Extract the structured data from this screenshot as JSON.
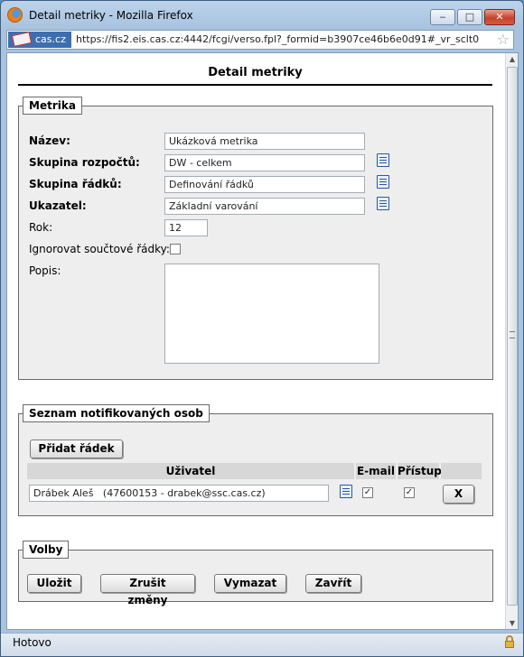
{
  "window": {
    "title": "Detail metriky - Mozilla Firefox",
    "controls": {
      "minimize": "‒",
      "maximize": "□",
      "close": "✕"
    }
  },
  "urlbar": {
    "site": "cas.cz",
    "url": "https://fis2.eis.cas.cz:4442/fcgi/verso.fpl?_formid=b3907ce46b6e0d91#_vr_sclt0",
    "bookmark_star": "☆"
  },
  "page": {
    "title": "Detail metriky"
  },
  "metrika": {
    "legend": "Metrika",
    "fields": {
      "nazev": {
        "label": "Název:",
        "value": "Ukázková metrika"
      },
      "skupina_rozpoctu": {
        "label": "Skupina rozpočtů:",
        "value": "DW - celkem"
      },
      "skupina_radku": {
        "label": "Skupina řádků:",
        "value": "Definování řádků"
      },
      "ukazatel": {
        "label": "Ukazatel:",
        "value": "Základní varování"
      },
      "rok": {
        "label": "Rok:",
        "value": "12"
      },
      "ignorovat": {
        "label": "Ignorovat součtové řádky:",
        "checked": false
      },
      "popis": {
        "label": "Popis:",
        "value": ""
      }
    }
  },
  "notifikace": {
    "legend": "Seznam notifikovaných osob",
    "add_row_label": "Přidat řádek",
    "columns": {
      "user": "Uživatel",
      "email": "E-mail",
      "access": "Přístup"
    },
    "rows": [
      {
        "user": "Drábek Aleš   (47600153 - drabek@ssc.cas.cz)",
        "email": true,
        "access": true,
        "delete_label": "X"
      }
    ]
  },
  "volby": {
    "legend": "Volby",
    "buttons": {
      "save": "Uložit",
      "cancel": "Zrušit změny",
      "delete": "Vymazat",
      "close": "Zavřít"
    }
  },
  "status": {
    "text": "Hotovo"
  }
}
